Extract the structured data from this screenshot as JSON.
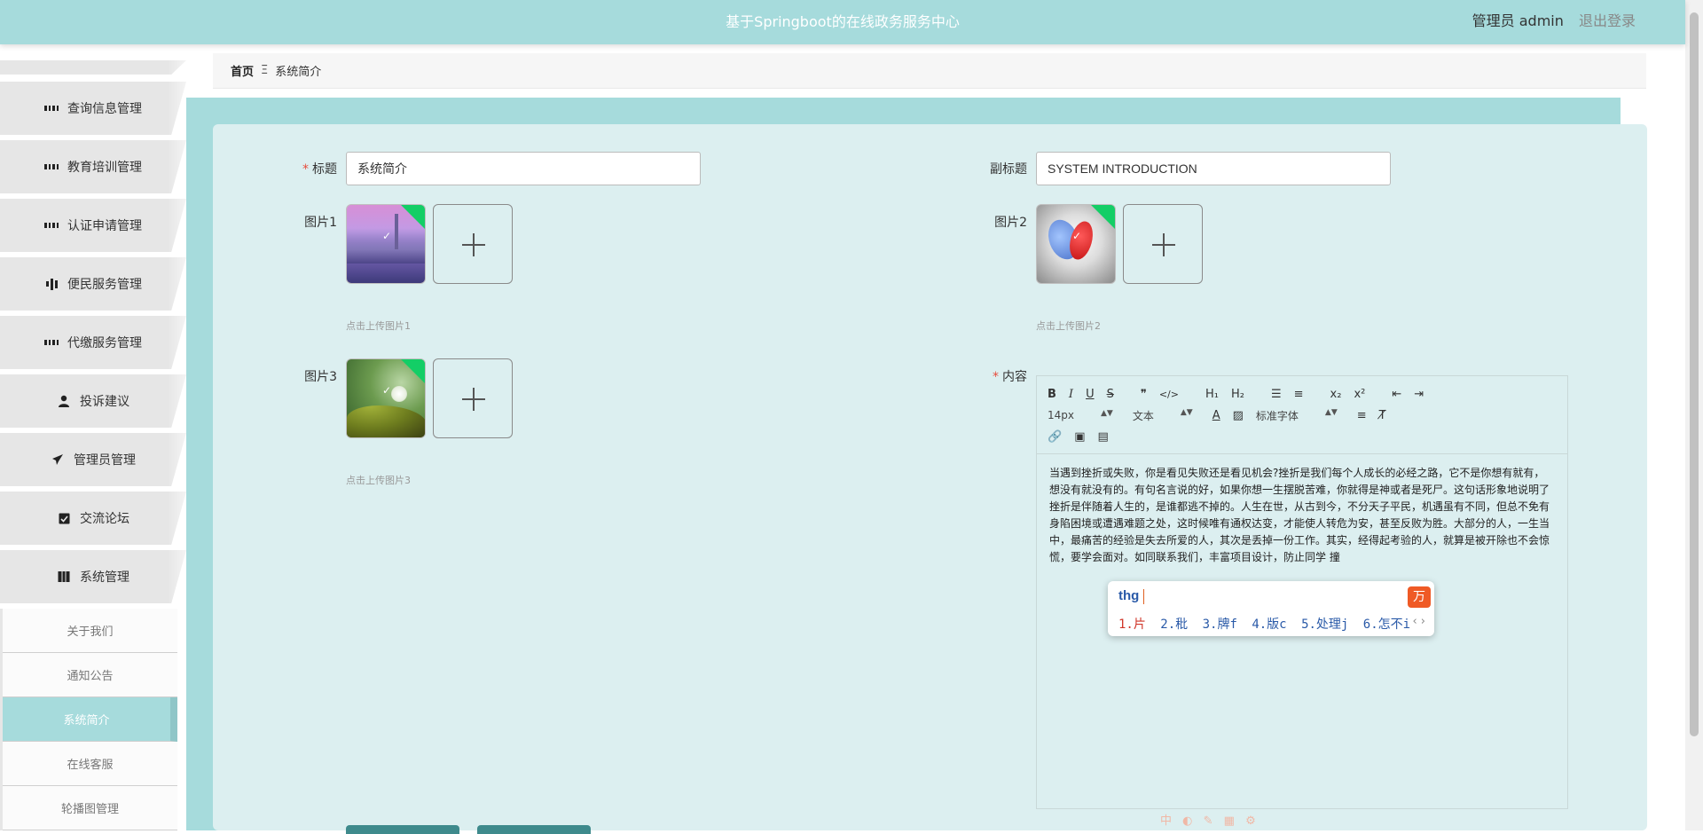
{
  "header": {
    "app_title": "基于Springboot的在线政务服务中心",
    "user_label": "管理员 admin",
    "logout_label": "退出登录"
  },
  "sidebar": {
    "items": [
      {
        "label": "查询信息管理",
        "icon": "grid-icon"
      },
      {
        "label": "教育培训管理",
        "icon": "grid-icon"
      },
      {
        "label": "认证申请管理",
        "icon": "grid-icon"
      },
      {
        "label": "便民服务管理",
        "icon": "bar-chart-icon"
      },
      {
        "label": "代缴服务管理",
        "icon": "grid-icon"
      },
      {
        "label": "投诉建议",
        "icon": "user-icon"
      },
      {
        "label": "管理员管理",
        "icon": "paper-plane-icon"
      },
      {
        "label": "交流论坛",
        "icon": "clipboard-check-icon"
      },
      {
        "label": "系统管理",
        "icon": "book-icon"
      }
    ],
    "submenu": [
      {
        "label": "关于我们"
      },
      {
        "label": "通知公告"
      },
      {
        "label": "系统简介",
        "active": true
      },
      {
        "label": "在线客服"
      },
      {
        "label": "轮播图管理"
      }
    ]
  },
  "breadcrumb": {
    "home": "首页",
    "separator": "Ξ",
    "current": "系统简介"
  },
  "form": {
    "title_label": "标题",
    "title_value": "系统简介",
    "subtitle_label": "副标题",
    "subtitle_value": "SYSTEM INTRODUCTION",
    "image1_label": "图片1",
    "image1_hint": "点击上传图片1",
    "image2_label": "图片2",
    "image2_hint": "点击上传图片2",
    "image3_label": "图片3",
    "image3_hint": "点击上传图片3",
    "content_label": "内容",
    "required_mark": "*"
  },
  "editor": {
    "toolbar": {
      "font_size": "14px",
      "text_type": "文本",
      "font_family": "标准字体"
    },
    "content": "当遇到挫折或失败，你是看见失败还是看见机会?挫折是我们每个人成长的必经之路，它不是你想有就有，想没有就没有的。有句名言说的好，如果你想一生摆脱苦难，你就得是神或者是死尸。这句话形象地说明了挫折是伴随着人生的，是谁都逃不掉的。人生在世，从古到今，不分天子平民，机遇虽有不同，但总不免有身陷困境或遭遇难题之处，这时候唯有通权达变，才能使人转危为安，甚至反败为胜。大部分的人，一生当中，最痛苦的经验是失去所爱的人，其次是丢掉一份工作。其实，经得起考验的人，就算是被开除也不会惊慌，要学会面对。如同联系我们，丰富项目设计，防止同学 撞"
  },
  "ime": {
    "typed": "thg",
    "candidates": [
      "1.片",
      "2.秕",
      "3.牌f",
      "4.版c",
      "5.处理j",
      "6.怎不i"
    ],
    "logo": "万"
  },
  "ime_bar": "中"
}
